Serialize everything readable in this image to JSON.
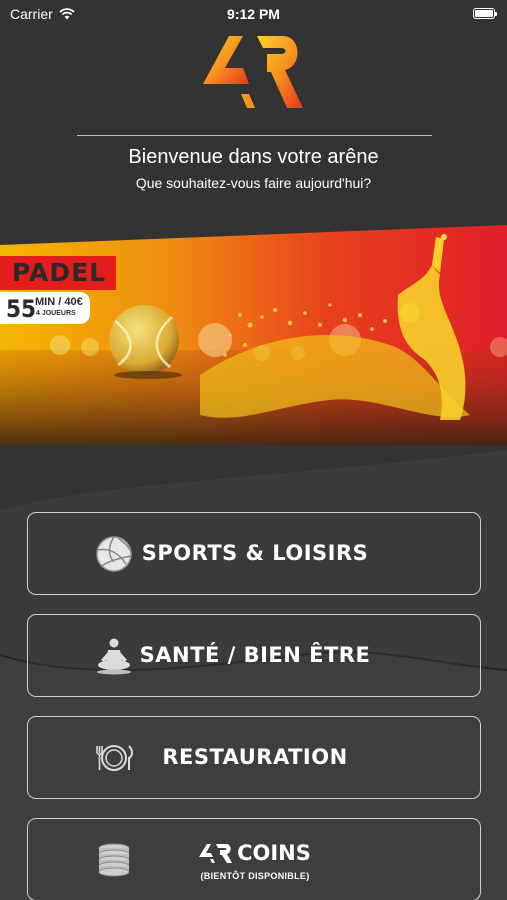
{
  "status_bar": {
    "carrier": "Carrier",
    "time": "9:12 PM"
  },
  "header": {
    "logo_text": "AR",
    "title": "Bienvenue dans votre arêne",
    "subtitle": "Que souhaitez-vous faire aujourd'hui?"
  },
  "banner": {
    "tag": "PADEL",
    "duration": "55",
    "price": "MIN / 40€",
    "players": "4 JOUEURS"
  },
  "menu": {
    "sports": {
      "label": "SPORTS & LOISIRS",
      "icon": "volleyball-icon"
    },
    "sante": {
      "label": "SANTÉ / BIEN ÊTRE",
      "icon": "meditation-icon"
    },
    "restauration": {
      "label": "RESTAURATION",
      "icon": "plate-cutlery-icon"
    },
    "coins": {
      "label": "COINS",
      "sublabel": "(BIENTÔT DISPONIBLE)",
      "icon": "coins-stack-icon"
    }
  },
  "colors": {
    "background": "#333333",
    "brand_orange": "#f39c12",
    "brand_red": "#e31c1c",
    "button_border": "#cfcfcf"
  }
}
